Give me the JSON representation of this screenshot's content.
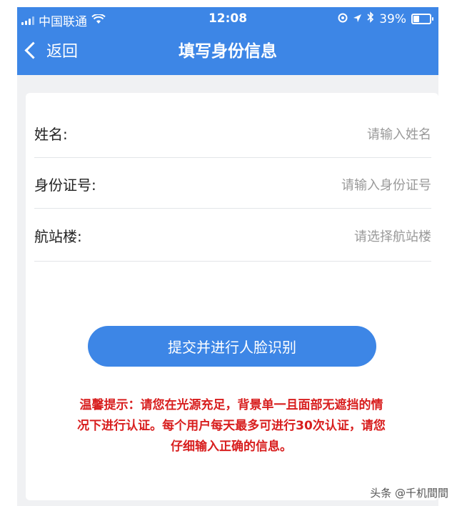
{
  "status_bar": {
    "carrier": "中国联通",
    "time": "12:08",
    "battery": "39%",
    "battery_level": 0.39
  },
  "nav": {
    "back_label": "返回",
    "title": "填写身份信息"
  },
  "form": {
    "fields": [
      {
        "label": "姓名:",
        "placeholder": "请输入姓名"
      },
      {
        "label": "身份证号:",
        "placeholder": "请输入身份证号"
      },
      {
        "label": "航站楼:",
        "placeholder": "请选择航站楼"
      }
    ],
    "submit_label": "提交并进行人脸识别"
  },
  "tip": {
    "line1": "温馨提示：请您在光源充足，背景单一且面部无遮挡的情",
    "line2": "况下进行认证。每个用户每天最多可进行30次认证，请您",
    "line3": "仔细输入正确的信息。"
  },
  "watermark": "头条 @千机間間",
  "colors": {
    "primary": "#3d86e6",
    "warning": "#d81e1e"
  },
  "icons": [
    "signal-icon",
    "wifi-icon",
    "location-lock-icon",
    "arrow-icon",
    "bluetooth-icon",
    "battery-icon",
    "back-chevron-icon"
  ]
}
